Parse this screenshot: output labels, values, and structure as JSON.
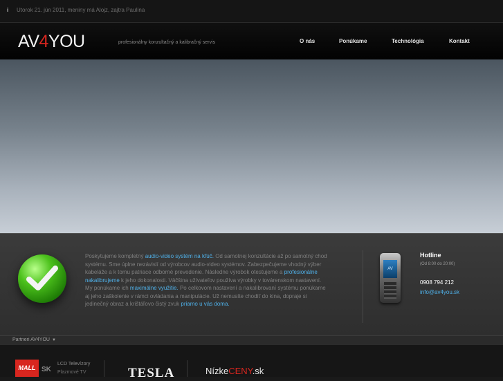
{
  "topbar": {
    "icon": "info-icon",
    "date_text": "Utorok 21. jún 2011, meniny má Alojz, zajtra Paulína"
  },
  "header": {
    "logo_part1": "AV",
    "logo_part2": "4",
    "logo_part3": "YOU",
    "tagline": "profesionálny konzultačný a kalibračný servis",
    "nav": [
      "O nás",
      "Ponúkame",
      "Technológia",
      "Kontakt"
    ]
  },
  "intro": {
    "t1": "Poskytujeme kompletný ",
    "h1": "audio-video systém na kľúč.",
    "t2": " Od samotnej konzultácie až po samotný chod systému. Sme úplne nezávislí od výrobcov audio-video systémov. Zabezpečujeme vhodný výber kabeláže a k tomu patriace odborné prevedenie. Následne výrobok otestujeme a ",
    "h2": "profesionálne nakalibrujeme",
    "t3": " k jeho dokonalosti. Väčšina užívateľov používa výrobky v továrenskom nastavení. My ponúkame ich ",
    "h3": "maximálne využitie.",
    "t4": " Po celkovom nastavení a nakalibrovaní systému ponúkame aj jeho zaškolenie v rámci ovládania a manipulácie. Už nemusíte chodiť do kina, dopraje si jedinečný obraz a krištáľovo čistý zvuk ",
    "h4": "priamo u vás doma."
  },
  "hotline": {
    "title": "Hotline",
    "hours": "(Od 8:00 do 20:00)",
    "phone": "0908 794 212",
    "email": "info@av4you.sk",
    "phone_screen": "AV"
  },
  "partners": {
    "label": "Partneri AV4YOU",
    "caret_icon": "caret-down-icon",
    "mall_logo": "MALL",
    "mall_sk": "SK",
    "mall_line1": "LCD Televízory",
    "mall_line2": "Plazmové TV",
    "tesla": "TESLA",
    "nizke_part1": "Nízke",
    "nizke_part2": "CENY",
    "nizke_part3": ".sk"
  },
  "colors": {
    "accent_blue": "#4fb0e8",
    "brand_red": "#d8261f"
  }
}
